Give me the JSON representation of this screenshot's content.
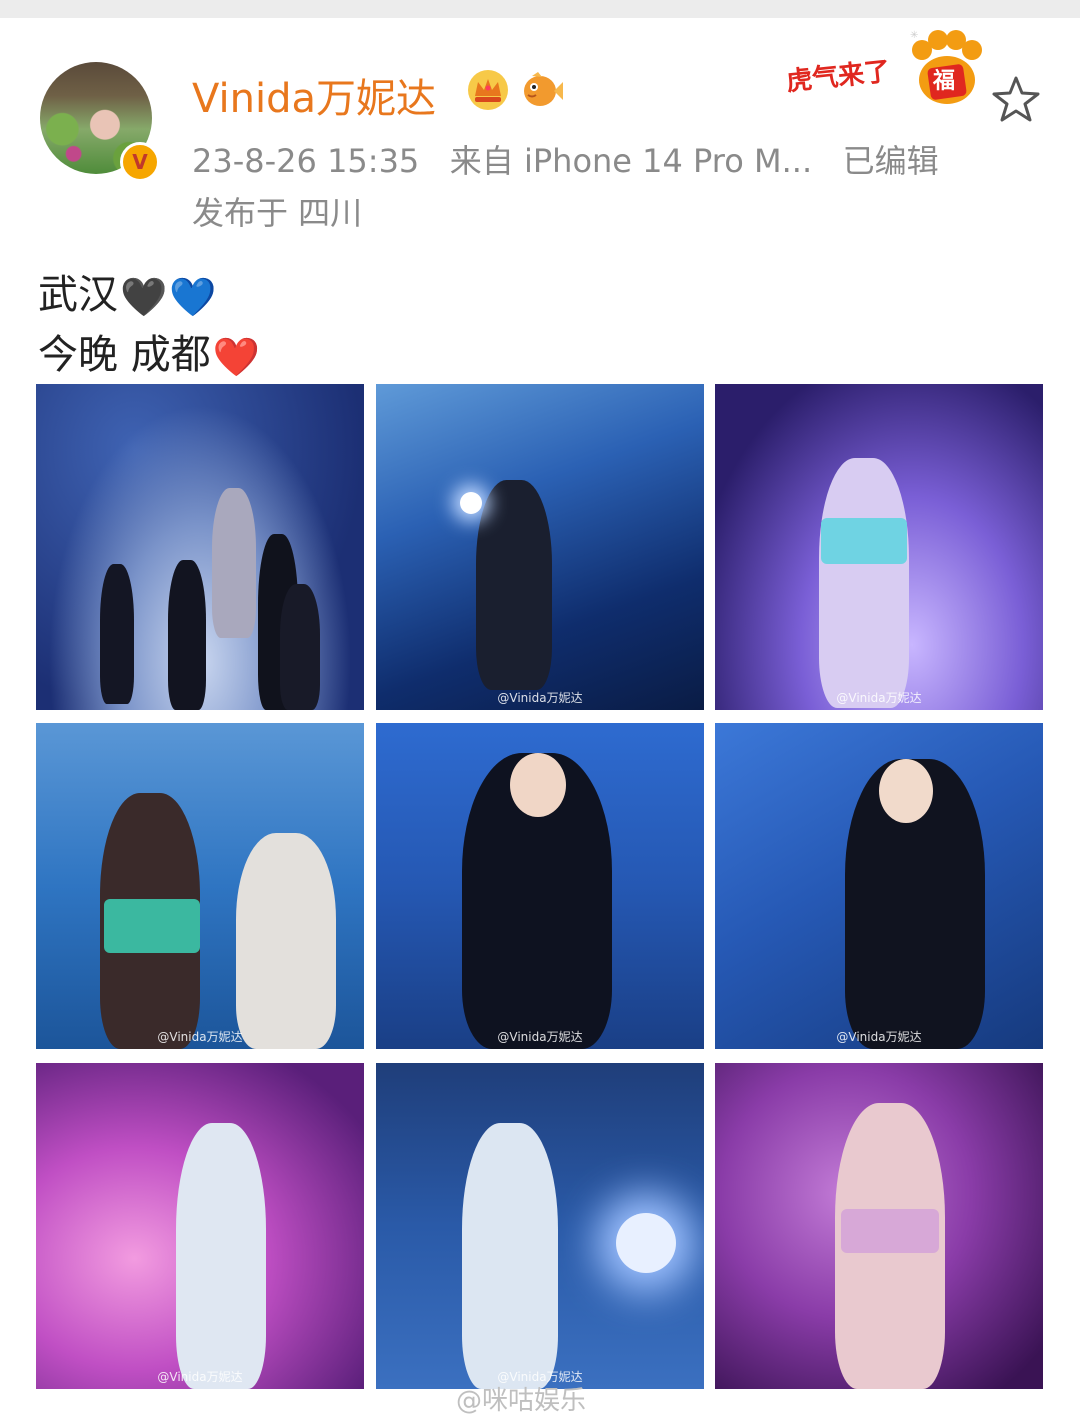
{
  "post": {
    "username": "Vinida万妮达",
    "timestamp": "23-8-26 15:35",
    "source": "来自 iPhone 14 Pro M...",
    "edited": "已编辑",
    "location": "发布于 四川",
    "text_line1": "武汉",
    "text_line2": "今晚 成都",
    "emoji_line1": [
      "🖤",
      "💙"
    ],
    "emoji_line2": [
      "❤️"
    ]
  },
  "badges": {
    "verified": "V",
    "campaign_text": "虎气来了",
    "campaign_char": "福",
    "icons": [
      "crown-icon",
      "fish-icon",
      "star-icon"
    ]
  },
  "images": {
    "watermark": "@Vinida万妮达",
    "tiles": [
      {
        "id": "photo-1",
        "has_watermark": false
      },
      {
        "id": "photo-2",
        "has_watermark": true
      },
      {
        "id": "photo-3",
        "has_watermark": true
      },
      {
        "id": "photo-4",
        "has_watermark": true
      },
      {
        "id": "photo-5",
        "has_watermark": true
      },
      {
        "id": "photo-6",
        "has_watermark": true
      },
      {
        "id": "photo-7",
        "has_watermark": true
      },
      {
        "id": "photo-8",
        "has_watermark": true
      },
      {
        "id": "photo-9",
        "has_watermark": false
      }
    ]
  },
  "footer": {
    "repost_watermark": "@咪咕娱乐"
  },
  "colors": {
    "username": "#e8771d",
    "meta": "#8a8a8a",
    "text": "#222222"
  }
}
